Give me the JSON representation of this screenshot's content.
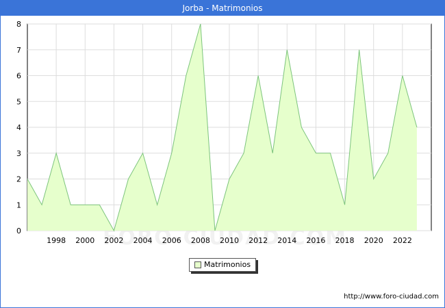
{
  "title": "Jorba - Matrimonios",
  "watermark": "FORO-CIUDAD.COM",
  "source": "http://www.foro-ciudad.com",
  "colors": {
    "header": "#3a74d8",
    "area_fill": "#e6ffcc",
    "line": "#7cc47c",
    "grid": "#dddddd"
  },
  "chart_data": {
    "type": "area",
    "title": "Jorba - Matrimonios",
    "xlabel": "",
    "ylabel": "",
    "x": [
      1996,
      1997,
      1998,
      1999,
      2000,
      2001,
      2002,
      2003,
      2004,
      2005,
      2006,
      2007,
      2008,
      2009,
      2010,
      2011,
      2012,
      2013,
      2014,
      2015,
      2016,
      2017,
      2018,
      2019,
      2020,
      2021,
      2022,
      2023
    ],
    "series": [
      {
        "name": "Matrimonios",
        "values": [
          2,
          1,
          3,
          1,
          1,
          1,
          0,
          2,
          3,
          1,
          3,
          6,
          8,
          0,
          2,
          3,
          6,
          3,
          7,
          4,
          3,
          3,
          1,
          7,
          2,
          3,
          6,
          4
        ]
      }
    ],
    "x_ticks": [
      "1998",
      "2000",
      "2002",
      "2004",
      "2006",
      "2008",
      "2010",
      "2012",
      "2014",
      "2016",
      "2018",
      "2020",
      "2022"
    ],
    "y_ticks": [
      "0",
      "1",
      "2",
      "3",
      "4",
      "5",
      "6",
      "7",
      "8"
    ],
    "xlim": [
      1996,
      2024
    ],
    "ylim": [
      0,
      8
    ],
    "grid": true,
    "legend": {
      "position": "bottom-center",
      "entries": [
        "Matrimonios"
      ]
    }
  }
}
